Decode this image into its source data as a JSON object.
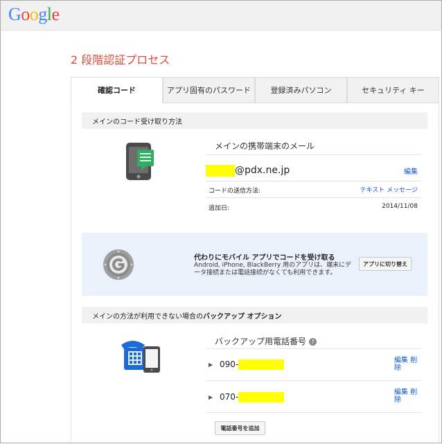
{
  "logo": {
    "letters": [
      "G",
      "o",
      "o",
      "g",
      "l",
      "e"
    ],
    "colors": [
      "#4285f4",
      "#ea4335",
      "#fbbc05",
      "#4285f4",
      "#34a853",
      "#ea4335"
    ]
  },
  "page": {
    "title": "2 段階認証プロセス"
  },
  "tabs": [
    {
      "label": "確認コード",
      "active": true
    },
    {
      "label": "アプリ固有のパスワード",
      "active": false
    },
    {
      "label": "登録済みパソコン",
      "active": false
    },
    {
      "label": "セキュリティ キー",
      "active": false
    }
  ],
  "primary": {
    "section_title": "メインのコード受け取り方法",
    "heading": "メインの携帯端末のメール",
    "email_domain": "@pdx.ne.jp",
    "edit_link": "編集",
    "send_method_label": "コードの送信方法:",
    "send_method_value": "テキスト メッセージ",
    "added_label": "追加日:",
    "added_value": "2014/11/08"
  },
  "promo": {
    "title": "代わりにモバイル アプリでコードを受け取る",
    "desc": "Android, iPhone, BlackBerry 用のアプリは、端末にデータ接続または電話接続がなくても利用できます。",
    "button": "アプリに切り替え"
  },
  "backup": {
    "section_prefix": "メインの方法が利用できない場合の",
    "section_bold": "バックアップ オプション",
    "heading": "バックアップ用電話番号",
    "help_glyph": "?",
    "phones": [
      {
        "prefix": "090-",
        "edit": "編集",
        "delete": "削除"
      },
      {
        "prefix": "070-",
        "edit": "編集",
        "delete": "削除"
      }
    ],
    "add_button": "電話番号を追加"
  },
  "colors": {
    "accent": "#dd4b39",
    "link": "#1155cc",
    "mask": "#ffff00",
    "promo_bg": "#ebf1fb"
  }
}
